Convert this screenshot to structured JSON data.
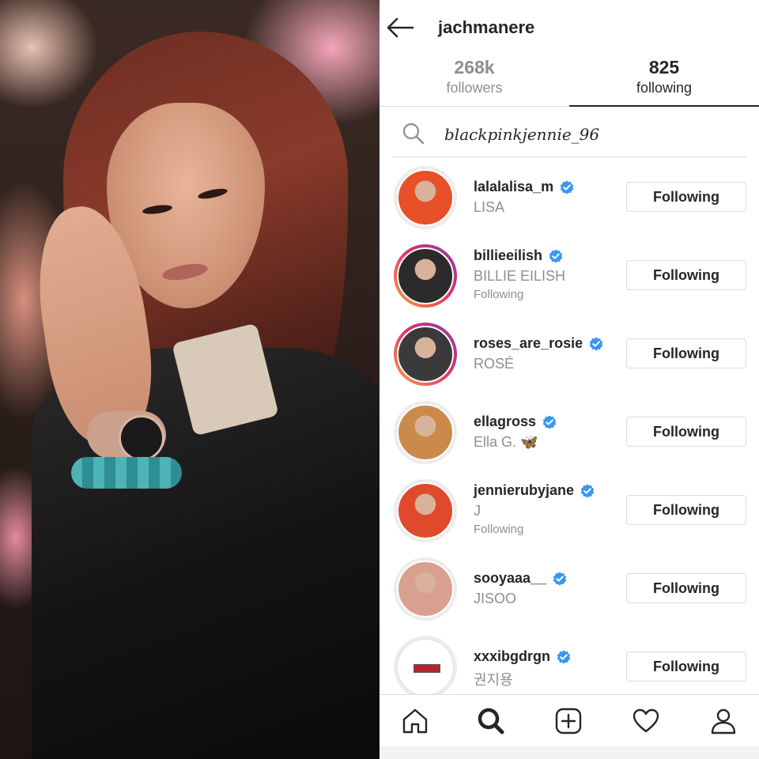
{
  "header": {
    "username": "jachmanere"
  },
  "tabs": [
    {
      "count": "268k",
      "label": "followers"
    },
    {
      "count": "825",
      "label": "following"
    }
  ],
  "search": {
    "value": "blackpinkjennie_96"
  },
  "accounts": [
    {
      "username": "lalalalisa_m",
      "name": "LISA",
      "sub": "",
      "button": "Following",
      "avatar_color": "#e8502a"
    },
    {
      "username": "billieeilish",
      "name": "BILLIE EILISH",
      "sub": "Following",
      "button": "Following",
      "avatar_color": "#2b2b2b"
    },
    {
      "username": "roses_are_rosie",
      "name": "ROSÉ",
      "sub": "",
      "button": "Following",
      "avatar_color": "#3a3a3a"
    },
    {
      "username": "ellagross",
      "name": "Ella G. 🦋",
      "sub": "",
      "button": "Following",
      "avatar_color": "#c98a4b"
    },
    {
      "username": "jennierubyjane",
      "name": "J",
      "sub": "Following",
      "button": "Following",
      "avatar_color": "#e04a2c"
    },
    {
      "username": "sooyaaa__",
      "name": "JISOO",
      "sub": "",
      "button": "Following",
      "avatar_color": "#d9a08f"
    },
    {
      "username": "xxxibgdrgn",
      "name": "권지용",
      "sub": "",
      "button": "Following",
      "avatar_color": "#ffffff"
    }
  ],
  "nav": [
    "home-icon",
    "search-icon",
    "add-post-icon",
    "activity-heart-icon",
    "profile-icon"
  ],
  "colors": {
    "verified": "#3897f0",
    "text": "#262626",
    "muted": "#8e8e8e",
    "border": "#dbdbdb"
  }
}
